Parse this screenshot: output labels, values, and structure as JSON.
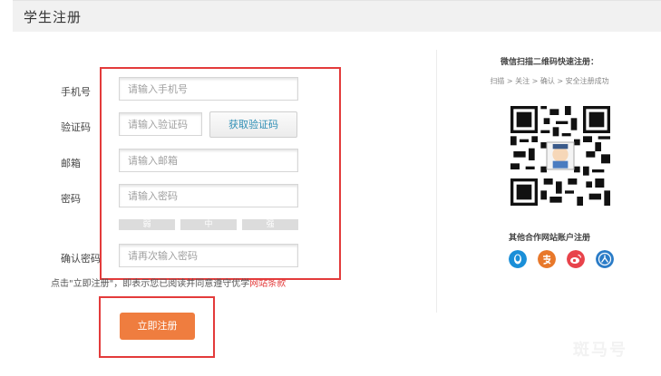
{
  "page": {
    "title": "学生注册"
  },
  "form": {
    "phone": {
      "label": "手机号",
      "placeholder": "请输入手机号"
    },
    "code": {
      "label": "验证码",
      "placeholder": "请输入验证码",
      "button": "获取验证码"
    },
    "email": {
      "label": "邮箱",
      "placeholder": "请输入邮箱"
    },
    "password": {
      "label": "密码",
      "placeholder": "请输入密码"
    },
    "strength": [
      "弱",
      "中",
      "强"
    ],
    "confirm": {
      "label": "确认密码",
      "placeholder": "请再次输入密码"
    },
    "agree_prefix": "点击\"立即注册\"，即表示您已阅读并同意遵守优学",
    "agree_link": "网站条款",
    "submit": "立即注册"
  },
  "qr": {
    "title": "微信扫描二维码快速注册：",
    "steps": "扫描 > 关注 > 确认 > 安全注册成功"
  },
  "partners": {
    "title": "其他合作网站账户注册",
    "icons": [
      {
        "name": "qq-icon",
        "color": "#1a8fd8"
      },
      {
        "name": "alipay-icon",
        "color": "#e8782a"
      },
      {
        "name": "weibo-icon",
        "color": "#e8434b"
      },
      {
        "name": "renren-icon",
        "color": "#2b7cc7"
      }
    ]
  },
  "watermark": "斑马号",
  "colors": {
    "accent": "#ef7d3f",
    "highlight_border": "#e33b3b",
    "link": "#2f8fb5"
  }
}
